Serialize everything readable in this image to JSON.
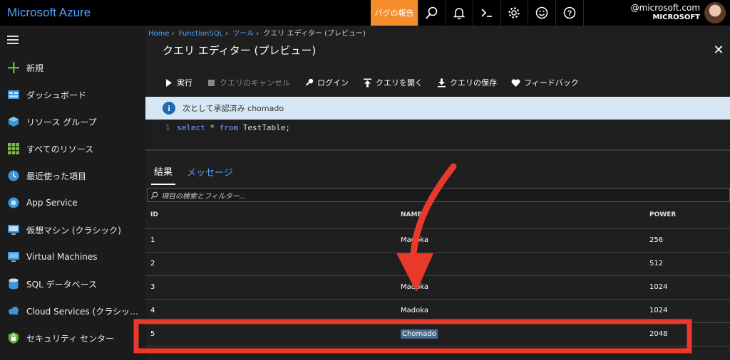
{
  "topbar": {
    "brand": "Microsoft Azure",
    "bug_report": "バグの報告",
    "account_email": "@microsoft.com",
    "account_org": "MICROSOFT"
  },
  "sidebar": {
    "items": [
      {
        "label": "新規",
        "icon": "plus-icon"
      },
      {
        "label": "ダッシュボード",
        "icon": "dashboard-icon"
      },
      {
        "label": "リソース グループ",
        "icon": "resource-group-icon"
      },
      {
        "label": "すべてのリソース",
        "icon": "grid-icon"
      },
      {
        "label": "最近使った項目",
        "icon": "clock-icon"
      },
      {
        "label": "App Service",
        "icon": "app-service-icon"
      },
      {
        "label": "仮想マシン (クラシック)",
        "icon": "vm-classic-icon"
      },
      {
        "label": "Virtual Machines",
        "icon": "vm-icon"
      },
      {
        "label": "SQL データベース",
        "icon": "sql-icon"
      },
      {
        "label": "Cloud Services (クラシッ…",
        "icon": "cloud-icon"
      },
      {
        "label": "セキュリティ センター",
        "icon": "lock-icon"
      }
    ]
  },
  "breadcrumb": [
    "Home",
    "FunctionSQL",
    "ツール",
    "クエリ エディター (プレビュー)"
  ],
  "panel": {
    "title": "クエリ エディター (プレビュー)",
    "commands": {
      "run": "実行",
      "cancel": "クエリのキャンセル",
      "login": "ログイン",
      "open": "クエリを開く",
      "save": "クエリの保存",
      "feedback": "フィードバック"
    },
    "info_text": "次として承認済み chomado",
    "editor": {
      "line_number": "1",
      "kw_select": "select",
      "star": " * ",
      "kw_from": "from",
      "rest": " TestTable;"
    },
    "tabs": {
      "results": "結果",
      "messages": "メッセージ"
    },
    "search_placeholder": "項目の検索とフィルター..."
  },
  "results": {
    "columns": [
      "ID",
      "NAME",
      "POWER"
    ],
    "rows": [
      [
        "1",
        "Madoka",
        "256"
      ],
      [
        "2",
        "",
        "512"
      ],
      [
        "3",
        "Madoka",
        "1024"
      ],
      [
        "4",
        "Madoka",
        "1024"
      ],
      [
        "5",
        "Chomado",
        "2048"
      ]
    ]
  },
  "colors": {
    "brand": "#4ea3ff",
    "bug_button": "#f58e2a",
    "annotation_red": "#e8392a",
    "info_bg": "#d6e6f5"
  }
}
